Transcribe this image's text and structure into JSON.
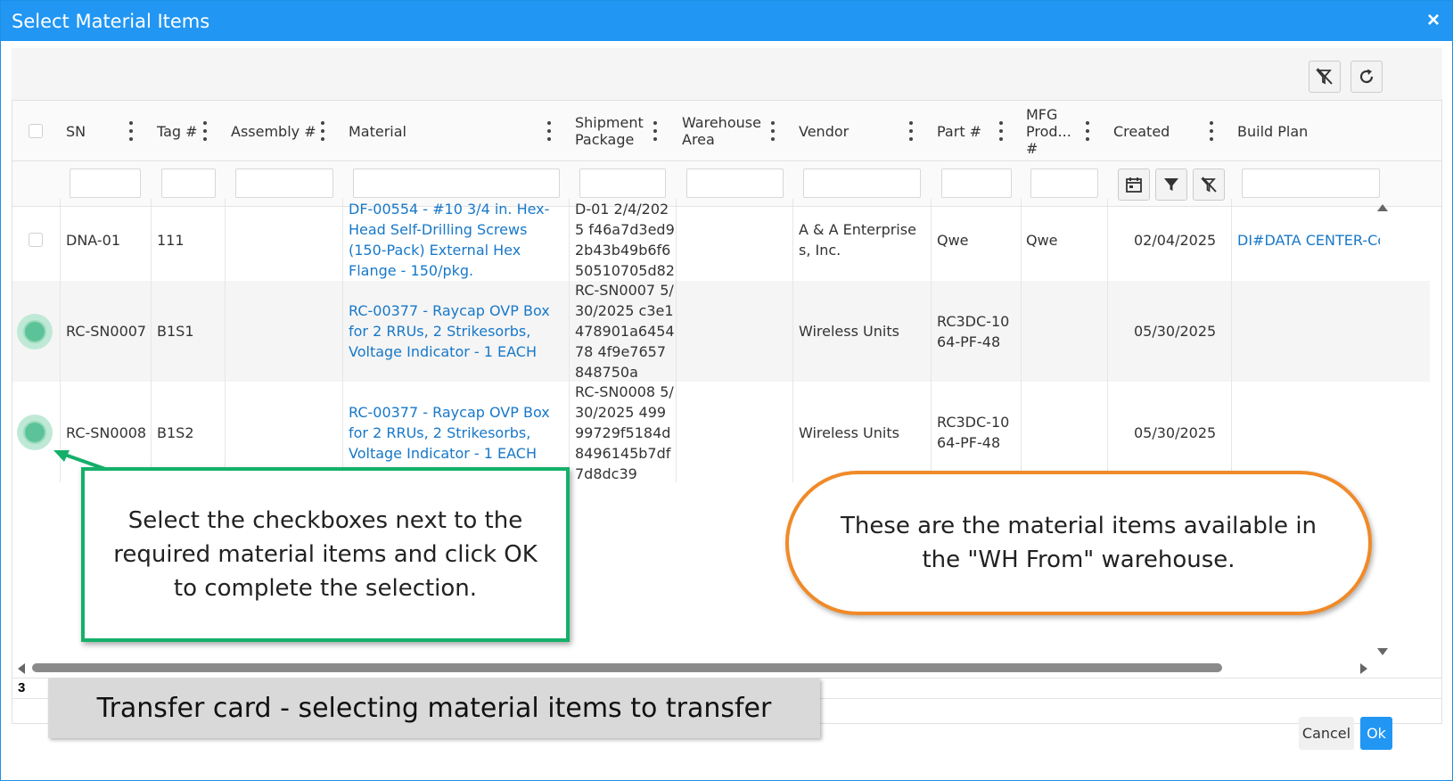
{
  "dialog": {
    "title": "Select Material Items",
    "close_icon": "×"
  },
  "grid": {
    "columns": [
      {
        "key": "sn",
        "label": "SN"
      },
      {
        "key": "tag",
        "label": "Tag #"
      },
      {
        "key": "assembly",
        "label": "Assembly #"
      },
      {
        "key": "material",
        "label": "Material"
      },
      {
        "key": "shipment",
        "label": "Shipment Package"
      },
      {
        "key": "warehouse",
        "label": "Warehouse Area"
      },
      {
        "key": "vendor",
        "label": "Vendor"
      },
      {
        "key": "part",
        "label": "Part #"
      },
      {
        "key": "mfg",
        "label": "MFG Prod... #"
      },
      {
        "key": "created",
        "label": "Created"
      },
      {
        "key": "buildplan",
        "label": "Build Plan"
      }
    ],
    "rows": [
      {
        "selected": false,
        "sn": "DNA-01",
        "tag": "111",
        "assembly": "",
        "material": "DF-00554 - #10 3/4 in. Hex-Head Self-Drilling Screws (150-Pack) External Hex Flange - 150/pkg.",
        "shipment": "D-01 2/4/2025 f46a7d3ed92b43b49b6f650510705d82",
        "warehouse": "",
        "vendor": "A & A Enterprises, Inc.",
        "part": "Qwe",
        "mfg": "Qwe",
        "created": "02/04/2025",
        "buildplan": "DI#DATA CENTER-Col"
      },
      {
        "selected": true,
        "sn": "RC-SN0007",
        "tag": "B1S1",
        "assembly": "",
        "material": "RC-00377 - Raycap OVP Box for 2 RRUs, 2 Strikesorbs, Voltage Indicator - 1 EACH",
        "shipment": "RC-SN0007 5/30/2025 c3e1478901a645478 4f9e7657848750a",
        "warehouse": "",
        "vendor": "Wireless Units",
        "part": "RC3DC-1064-PF-48",
        "mfg": "",
        "created": "05/30/2025",
        "buildplan": ""
      },
      {
        "selected": true,
        "sn": "RC-SN0008",
        "tag": "B1S2",
        "assembly": "",
        "material": "RC-00377 - Raycap OVP Box for 2 RRUs, 2 Strikesorbs, Voltage Indicator - 1 EACH",
        "shipment": "RC-SN0008 5/30/2025 49999729f5184d8496145b7df7d8dc39",
        "warehouse": "",
        "vendor": "Wireless Units",
        "part": "RC3DC-1064-PF-48",
        "mfg": "",
        "created": "05/30/2025",
        "buildplan": ""
      }
    ],
    "row_count": "3"
  },
  "buttons": {
    "cancel": "Cancel",
    "ok": "Ok"
  },
  "callouts": {
    "green": "Select the checkboxes next to the required material items and click OK to complete the selection.",
    "orange": "These are the material items available in the \"WH From\" warehouse.",
    "caption": "Transfer card - selecting material items to transfer"
  },
  "colors": {
    "titlebar": "#2196f3",
    "link": "#1878c8",
    "callout_green": "#14b06a",
    "callout_orange": "#f08a28",
    "ok_button": "#2196f3"
  }
}
